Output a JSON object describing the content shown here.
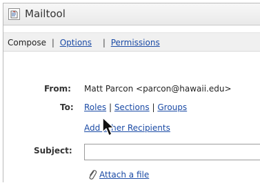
{
  "window": {
    "title": "Mailtool",
    "icon": "mail-document-icon"
  },
  "toolbar": {
    "compose_label": "Compose",
    "options_label": "Options",
    "permissions_label": "Permissions",
    "separator": "|"
  },
  "form": {
    "from_label": "From:",
    "from_value": "Matt Parcon <parcon@hawaii.edu>",
    "to_label": "To:",
    "to_links": {
      "roles": "Roles",
      "sections": "Sections",
      "groups": "Groups"
    },
    "add_recipients_label": "Add other Recipients",
    "subject_label": "Subject:",
    "subject_value": "",
    "attach_label": "Attach a file",
    "attach_icon": "paperclip-icon"
  },
  "cursor": {
    "icon": "mouse-pointer-icon"
  }
}
